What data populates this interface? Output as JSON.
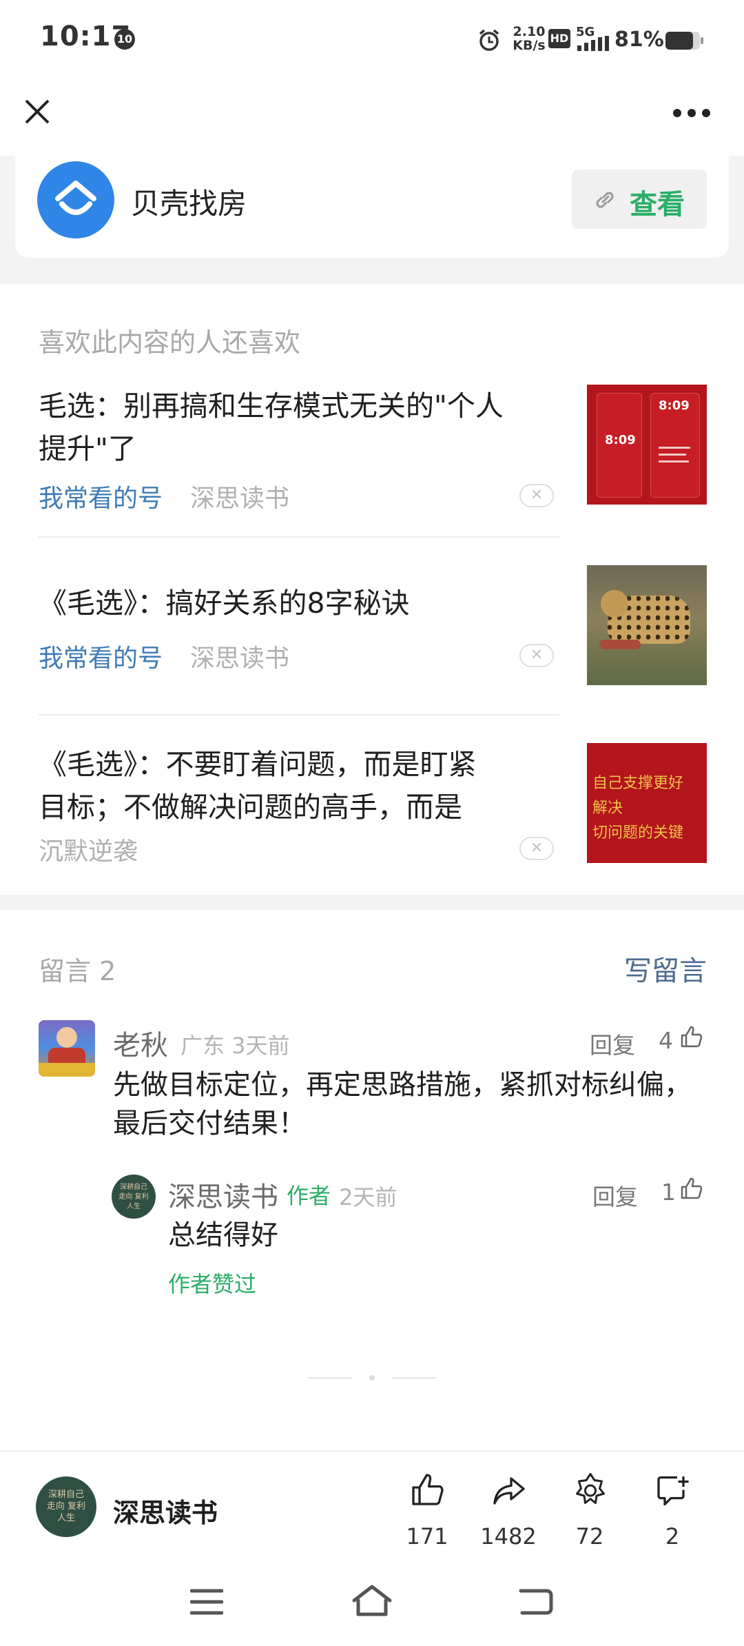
{
  "status_bar": {
    "time": "10:17",
    "notif_badge": "10",
    "net_speed_top": "2.10",
    "net_speed_bottom": "KB/s",
    "hd": "HD",
    "network": "5G",
    "battery": "81%"
  },
  "mini_program": {
    "name": "贝壳找房",
    "view_label": "查看"
  },
  "recommendations": {
    "section_title": "喜欢此内容的人还喜欢",
    "items": [
      {
        "title_line1": "毛选：别再搞和生存模式无关的\"个人",
        "title_line2": "提升\"了",
        "tag": "我常看的号",
        "source": "深思读书",
        "thumb": "red-phone-lockscreen"
      },
      {
        "title_line1": "《毛选》：搞好关系的8字秘诀",
        "title_line2": "",
        "tag": "我常看的号",
        "source": "深思读书",
        "thumb": "cheetah-photo"
      },
      {
        "title_line1": "《毛选》：不要盯着问题，而是盯紧",
        "title_line2": "目标；不做解决问题的高手，而是",
        "tag": "",
        "source": "沉默逆袭",
        "thumb": "red-calligraphy"
      }
    ],
    "thumb_texts": {
      "phone_time": "8:09",
      "calligraphy_line1": "自己支撑更好",
      "calligraphy_line2": "解决",
      "calligraphy_line3": "切问题的关键"
    }
  },
  "comments": {
    "header": "留言 2",
    "write_label": "写留言",
    "main": {
      "name": "老秋",
      "meta": "广东 3天前",
      "reply_label": "回复",
      "likes": "4",
      "text_line1": "先做目标定位，再定思路措施，紧抓对标纠偏，",
      "text_line2": "最后交付结果！"
    },
    "reply": {
      "name": "深思读书",
      "badge": "作者",
      "meta": "2天前",
      "reply_label": "回复",
      "likes": "1",
      "text": "总结得好",
      "liked_by_author": "作者赞过"
    }
  },
  "bottom_bar": {
    "account_name": "深思读书",
    "avatar_text": "深耕自己 走向 复利人生",
    "like_count": "171",
    "share_count": "1482",
    "wow_count": "72",
    "comment_count": "2"
  },
  "colors": {
    "accent_green": "#2aae67",
    "link_blue": "#3e7bb5",
    "app_blue": "#2f86e6"
  }
}
